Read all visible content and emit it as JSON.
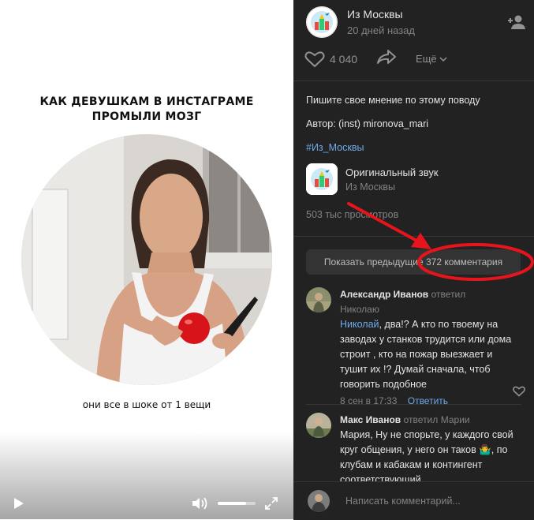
{
  "video": {
    "title_line1": "КАК ДЕВУШКАМ В ИНСТАГРАМЕ",
    "title_line2": "ПРОМЫЛИ МОЗГ",
    "caption": "они все в шоке от 1 вещи",
    "volume_level": 0.75
  },
  "post": {
    "author": "Из Москвы",
    "time": "20 дней назад",
    "likes": "4 040",
    "more_label": "Ещё",
    "desc_line1": "Пишите свое мнение по этому поводу",
    "desc_line2": "Автор: (inst) mironova_mari",
    "hashtag": "#Из_Москвы",
    "sound_title": "Оригинальный звук",
    "sound_author": "Из Москвы",
    "views": "503 тыс просмотров",
    "show_previous": "Показать предыдущие 372 комментария"
  },
  "comments": [
    {
      "author": "Александр Иванов",
      "replied": "ответил",
      "replied_to": "Николаю",
      "mention": "Николай",
      "text": ", два!? А кто по твоему на заводах у станков трудится или дома строит , кто на пожар выезжает и тушит их !? Думай сначала, чтоб говорить подобное",
      "date": "8 сен в 17:33",
      "reply_label": "Ответить"
    },
    {
      "author": "Макс Иванов",
      "replied": "ответил",
      "replied_to": "Марии",
      "text": "Мария, Ну не спорьте, у каждого свой круг общения, у него он таков 🤷‍♂️, по клубам и кабакам и контингент соответствующий."
    }
  ],
  "composer": {
    "placeholder": "Написать комментарий..."
  },
  "colors": {
    "panel_bg": "#222222",
    "link": "#71aaeb",
    "annotation": "#e8141b"
  }
}
